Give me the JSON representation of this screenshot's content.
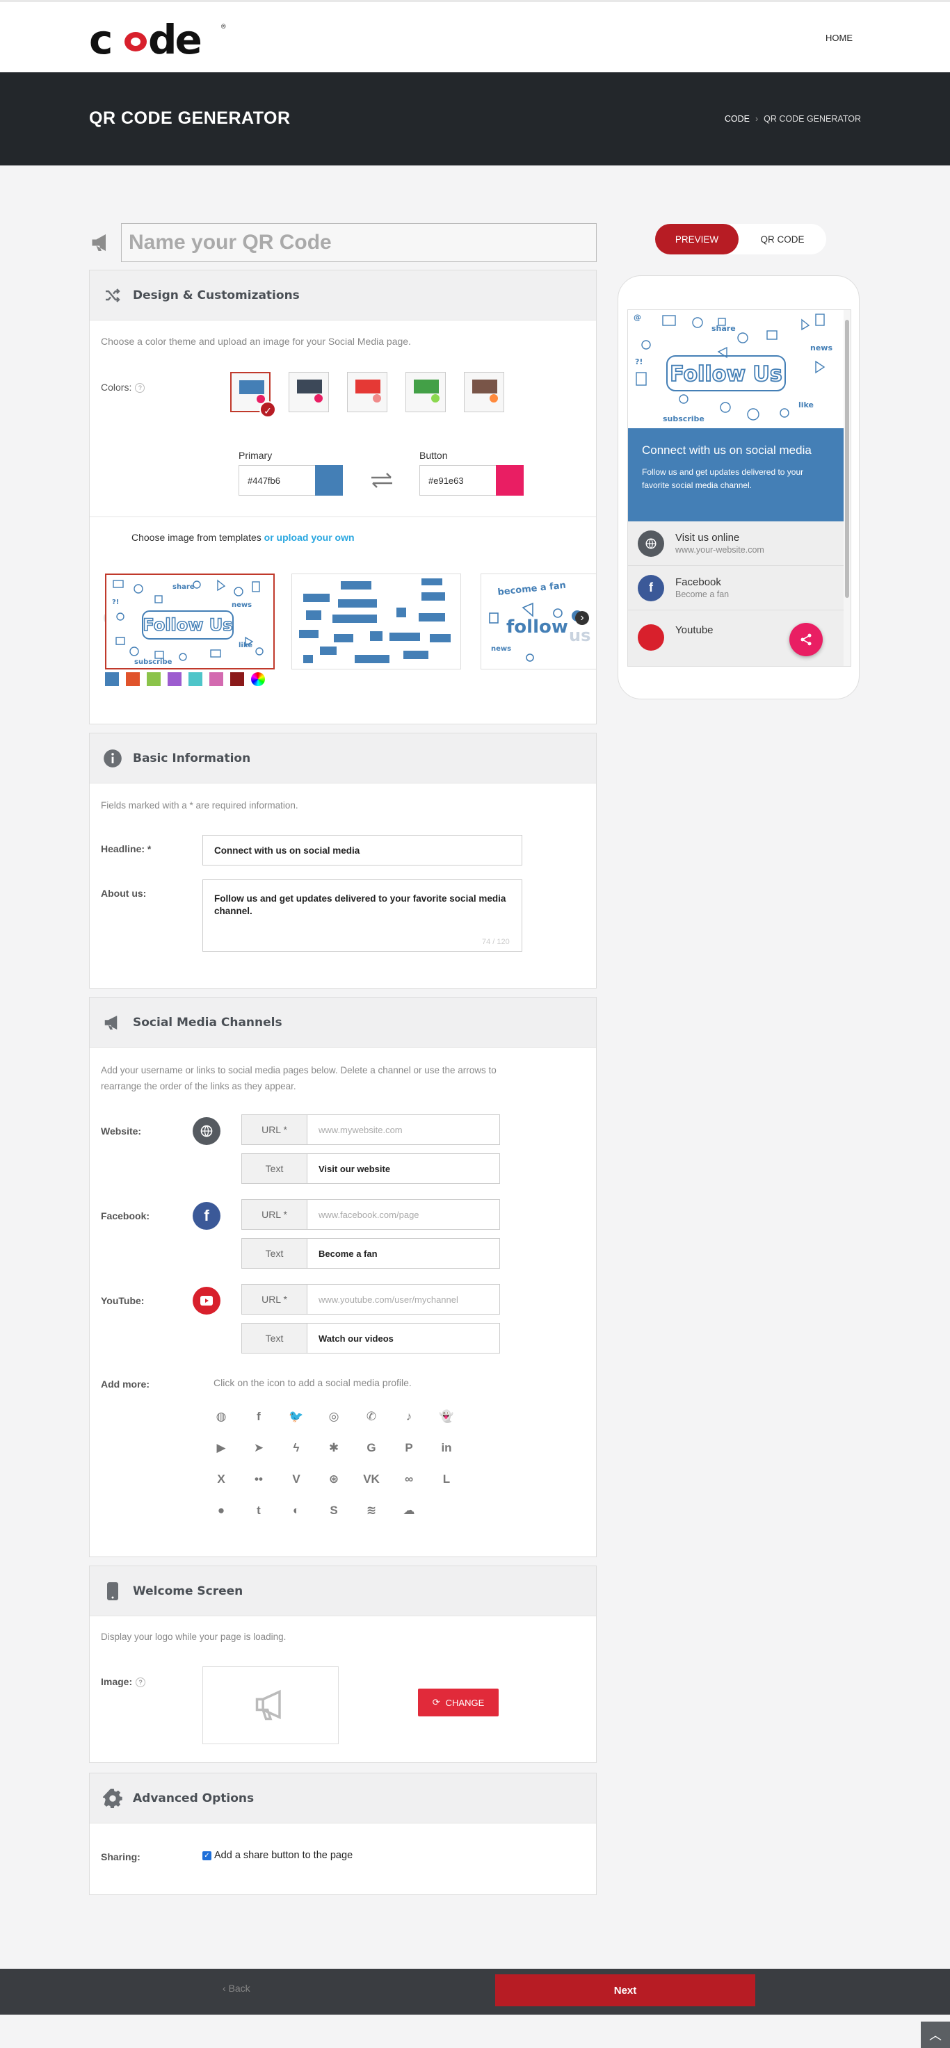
{
  "header": {
    "logo_text": "code",
    "nav_home": "HOME"
  },
  "hero": {
    "title": "QR CODE GENERATOR",
    "breadcrumb": [
      "CODE",
      "QR CODE GENERATOR"
    ]
  },
  "qr_name": {
    "placeholder": "Name your QR Code"
  },
  "design": {
    "title": "Design & Customizations",
    "description": "Choose a color theme and upload an image for your Social Media page.",
    "colors_label": "Colors:",
    "themes": [
      {
        "top": "#447fb6",
        "dot": "#e91e63",
        "selected": true
      },
      {
        "top": "#3c4858",
        "dot": "#e91e63",
        "selected": false
      },
      {
        "top": "#e53935",
        "dot": "#f08a8a",
        "selected": false
      },
      {
        "top": "#43a047",
        "dot": "#8bd84f",
        "selected": false
      },
      {
        "top": "#795548",
        "dot": "#ff8a3d",
        "selected": false
      }
    ],
    "primary_label": "Primary",
    "primary_value": "#447fb6",
    "button_label": "Button",
    "button_value": "#e91e63",
    "choose_text": "Choose image from templates",
    "upload_link": "or upload your own",
    "image_colors": [
      "#447fb6",
      "#e0532b",
      "#8bc34a",
      "#9c5ccf",
      "#4ec5c9",
      "#d36ab0",
      "#8b1a1a"
    ]
  },
  "basic": {
    "title": "Basic Information",
    "note": "Fields marked with a * are required information.",
    "headline_label": "Headline: *",
    "headline_value": "Connect with us on social media",
    "about_label": "About us:",
    "about_value": "Follow us and get updates delivered to your favorite social media channel.",
    "char_count": "74 / 120"
  },
  "social": {
    "title": "Social Media Channels",
    "note": "Add your username or links to social media pages below. Delete a channel or use the arrows to rearrange the order of the links as they appear.",
    "url_label": "URL *",
    "text_label": "Text",
    "channels": [
      {
        "name": "Website:",
        "url_placeholder": "www.mywebsite.com",
        "text": "Visit our website",
        "color": "#555a60"
      },
      {
        "name": "Facebook:",
        "url_placeholder": "www.facebook.com/page",
        "text": "Become a fan",
        "color": "#3b5998"
      },
      {
        "name": "YouTube:",
        "url_placeholder": "www.youtube.com/user/mychannel",
        "text": "Watch our videos",
        "color": "#d8202c"
      }
    ],
    "add_more_label": "Add more:",
    "add_more_hint": "Click on the icon to add a social media profile.",
    "icons": [
      [
        "globe-icon",
        "facebook-icon",
        "twitter-icon",
        "instagram-icon",
        "whatsapp-icon",
        "tiktok-icon",
        "snapchat-icon"
      ],
      [
        "youtube-icon",
        "telegram-icon",
        "messenger-icon",
        "yelp-icon",
        "google-icon",
        "pinterest-icon",
        "linkedin-icon"
      ],
      [
        "xing-icon",
        "flickr-icon",
        "vimeo-icon",
        "dribbble-icon",
        "vk-icon",
        "tripadvisor-icon",
        "line-icon"
      ],
      [
        "reddit-icon",
        "tumblr-icon",
        "github-icon",
        "skype-icon",
        "spotify-icon",
        "soundcloud-icon"
      ]
    ]
  },
  "welcome": {
    "title": "Welcome Screen",
    "note": "Display your logo while your page is loading.",
    "image_label": "Image:",
    "change_label": "CHANGE"
  },
  "advanced": {
    "title": "Advanced Options",
    "sharing_label": "Sharing:",
    "share_checkbox": "Add a share button to the page"
  },
  "preview": {
    "tab_preview": "PREVIEW",
    "tab_qr": "QR CODE",
    "banner_text": "Follow Us",
    "headline": "Connect with us on social media",
    "about": "Follow us and get updates delivered to your favorite social media channel.",
    "items": [
      {
        "title": "Visit us online",
        "sub": "www.your-website.com",
        "color": "#555a60"
      },
      {
        "title": "Facebook",
        "sub": "Become a fan",
        "color": "#3b5998"
      },
      {
        "title": "Youtube",
        "sub": "",
        "color": "#d8202c"
      }
    ]
  },
  "footer": {
    "back": "Back",
    "next": "Next"
  }
}
